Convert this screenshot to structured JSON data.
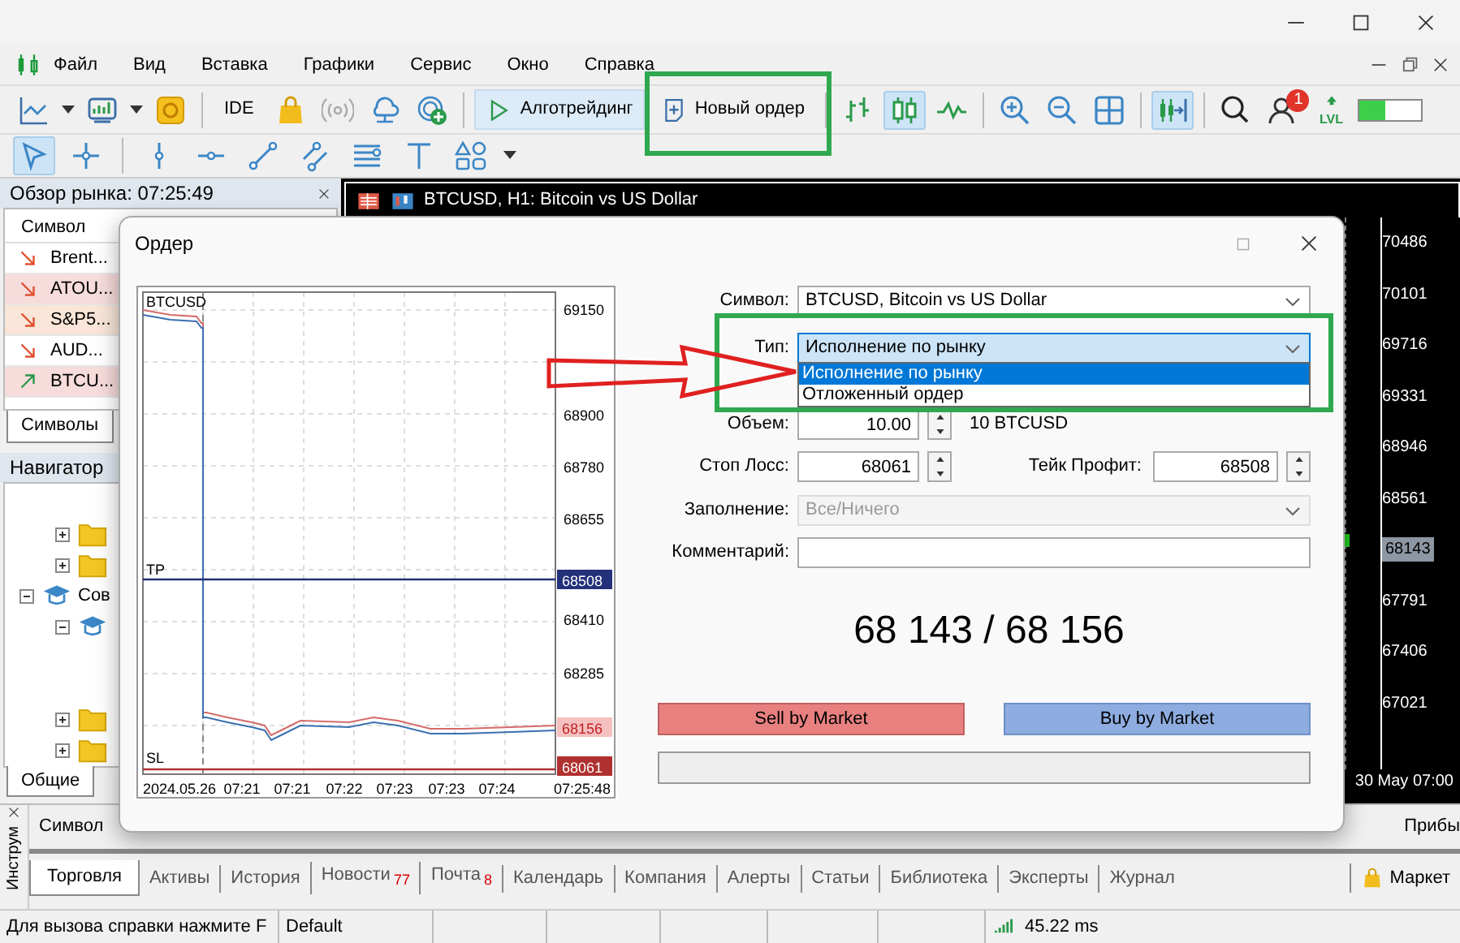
{
  "menu": [
    "Файл",
    "Вид",
    "Вставка",
    "Графики",
    "Сервис",
    "Окно",
    "Справка"
  ],
  "toolbar": {
    "ide_label": "IDE",
    "algo_label": "Алготрейдинг",
    "new_order": {
      "label": "Новый ордер",
      "highlighted": true
    },
    "chart_types": [
      {
        "selected": false
      },
      {
        "selected": true
      },
      {
        "selected": false
      }
    ],
    "autoscroll": {
      "selected": true
    },
    "notifications": "1",
    "level_label": "LVL",
    "meter": {
      "level": 0.42
    }
  },
  "drawing_tools": [
    {
      "selected": true
    },
    {
      "selected": false
    },
    {
      "selected": false
    },
    {
      "selected": false
    },
    {
      "selected": false
    },
    {
      "selected": false
    },
    {
      "selected": false
    },
    {
      "selected": false
    },
    {
      "selected": false
    }
  ],
  "market_watch": {
    "title": "Обзор рынка: 07:25:49",
    "column": "Символ",
    "tab": "Символы",
    "rows": [
      {
        "symbol": "Brent...",
        "kind": "down",
        "color": "#ffffff"
      },
      {
        "symbol": "ATOU...",
        "kind": "down",
        "color": "#f7dcdc"
      },
      {
        "symbol": "S&P5...",
        "kind": "down",
        "color": "#f9e6d8"
      },
      {
        "symbol": "AUD...",
        "kind": "down",
        "color": "#ffffff"
      },
      {
        "symbol": "BTCU...",
        "kind": "up",
        "color": "#f7dcdc"
      }
    ]
  },
  "navigator": {
    "title": "Навигатор",
    "tab": "Общие",
    "upper_items": [
      {
        "kind": "folder",
        "expanded": false
      },
      {
        "kind": "folder",
        "expanded": false
      }
    ],
    "items": [
      {
        "kind": "course",
        "label": "Сов",
        "expanded": true,
        "children": [
          {
            "kind": "course",
            "expanded": true
          },
          {
            "kind": "folder",
            "expanded": false
          },
          {
            "kind": "folder",
            "expanded": false
          }
        ]
      }
    ]
  },
  "chart_window": {
    "title": "BTCUSD, H1: Bitcoin vs US Dollar",
    "price_labels": [
      "70486",
      "70101",
      "69716",
      "69331",
      "68946",
      "68561"
    ],
    "current_price": "68143",
    "lower_labels": [
      "67791",
      "67406",
      "67021"
    ],
    "time_label": "30 May 07:00"
  },
  "order_dialog": {
    "title": "Ордер",
    "chart": {
      "symbol": "BTCUSD",
      "tp_label": "TP",
      "sl_label": "SL",
      "y_labels": [
        "69150",
        "68900",
        "68780",
        "68655",
        "68410",
        "68285"
      ],
      "tags": [
        {
          "text": "68508",
          "kind": "tp"
        },
        {
          "text": "68156",
          "kind": "ask"
        },
        {
          "text": "68061",
          "kind": "sl"
        }
      ],
      "x_labels": [
        "2024.05.26",
        "07:21",
        "07:21",
        "07:22",
        "07:23",
        "07:23",
        "07:24",
        "07:25:48"
      ]
    },
    "symbol": {
      "label": "Символ:",
      "value": "BTCUSD, Bitcoin vs US Dollar"
    },
    "type": {
      "label": "Тип:",
      "value": "Исполнение по рынку",
      "expanded": true,
      "highlighted": true,
      "pointer_arrow": true,
      "options": [
        {
          "label": "Исполнение по рынку",
          "selected": true
        },
        {
          "label": "Отложенный ордер",
          "selected": false
        }
      ]
    },
    "volume": {
      "label": "Объем:",
      "value": "10.00",
      "note": "10 BTCUSD"
    },
    "stop_loss": {
      "label": "Стоп Лосс:",
      "value": "68061"
    },
    "take_profit": {
      "label": "Тейк Профит:",
      "value": "68508"
    },
    "filling": {
      "label": "Заполнение:",
      "value": "Все/Ничего",
      "disabled": true
    },
    "comment": {
      "label": "Комментарий:"
    },
    "price": "68 143 / 68 156",
    "buttons": [
      {
        "label": "Sell by Market",
        "kind": "sell"
      },
      {
        "label": "Buy by Market",
        "kind": "buy"
      }
    ]
  },
  "toolbox": {
    "side_label": "Инструм",
    "columns": [
      "Символ",
      "Прибы"
    ],
    "tabs": [
      {
        "label": "Торговля",
        "selected": true
      },
      {
        "label": "Активы",
        "selected": false
      },
      {
        "label": "История",
        "selected": false
      },
      {
        "label": "Новости",
        "count": "77",
        "selected": false
      },
      {
        "label": "Почта",
        "count": "8",
        "selected": false
      },
      {
        "label": "Календарь",
        "selected": false
      },
      {
        "label": "Компания",
        "selected": false
      },
      {
        "label": "Алерты",
        "selected": false
      },
      {
        "label": "Статьи",
        "selected": false
      },
      {
        "label": "Библиотека",
        "selected": false
      },
      {
        "label": "Эксперты",
        "selected": false
      },
      {
        "label": "Журнал",
        "selected": false
      }
    ],
    "market_label": "Маркет"
  },
  "status_bar": {
    "help": "Для вызова справки нажмите F",
    "profile": "Default",
    "ping": "45.22 ms"
  }
}
